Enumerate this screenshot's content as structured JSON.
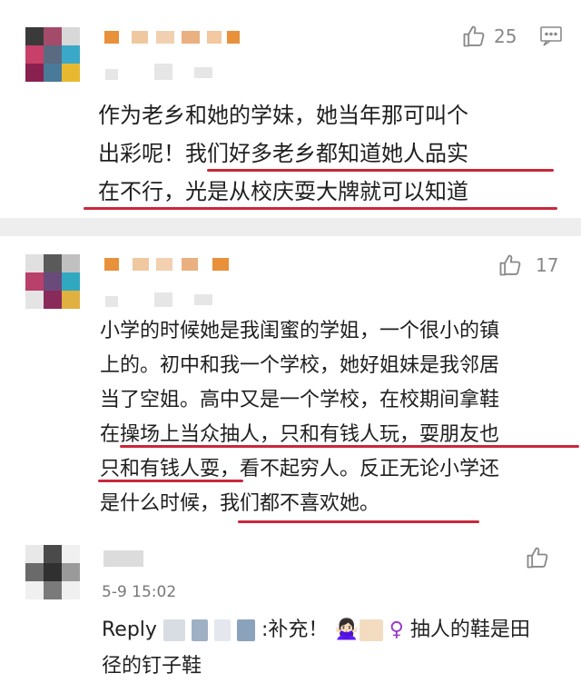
{
  "comments": [
    {
      "likes": "25",
      "text_lines": [
        "作为老乡和她的学妹，她当年那可叫个",
        "出彩呢！我们好多老乡都知道她人品实",
        "在不行，光是从校庆耍大牌就可以知道"
      ]
    },
    {
      "likes": "17",
      "text_lines": [
        "小学的时候她是我闺蜜的学姐，一个很小的镇",
        "上的。初中和我一个学校，她好姐妹是我邻居",
        "当了空姐。高中又是一个学校，在校期间拿鞋",
        "在操场上当众抽人，只和有钱人玩，耍朋友也",
        "只和有钱人耍，看不起穷人。反正无论小学还",
        "是什么时候，我们都不喜欢她。"
      ]
    },
    {
      "time": "5-9 15:02",
      "reply_prefix": "Reply",
      "reply_colon_text": ":补充！",
      "reply_emoji_1": "🙅🏻‍♀️",
      "reply_emoji_2": "♀",
      "reply_after": " 抽人的鞋是田",
      "reply_line2": "径的钉子鞋"
    }
  ],
  "colors": {
    "underline": "#c8283c",
    "separator": "#eeeeee",
    "meta": "#888888"
  },
  "icons": [
    "thumbs-up-icon",
    "comment-icon"
  ]
}
